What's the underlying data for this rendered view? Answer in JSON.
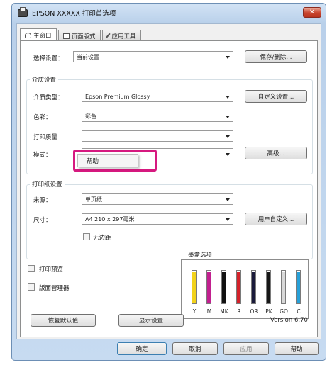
{
  "window": {
    "title": "EPSON XXXXX 打印首选项",
    "close": "✕"
  },
  "tabs": [
    {
      "label": "主窗口",
      "icon": "main-tab-icon"
    },
    {
      "label": "页面版式",
      "icon": "page-layout-icon"
    },
    {
      "label": "应用工具",
      "icon": "utility-tools-icon"
    }
  ],
  "select_setting": {
    "label": "选择设置：",
    "value": "当前设置",
    "save_button": "保存/删除..."
  },
  "media": {
    "group_title": "介质设置",
    "media_type_label": "介质类型：",
    "media_type_value": "Epson Premium Glossy",
    "custom_button": "自定义设置...",
    "color_label": "色彩：",
    "color_value": "彩色",
    "quality_label": "打印质量",
    "quality_value": "",
    "mode_label": "模式：",
    "mode_value": "",
    "advanced_button": "高级..."
  },
  "help_popup": {
    "label": "帮助"
  },
  "paper": {
    "group_title": "打印纸设置",
    "source_label": "来源：",
    "source_value": "单页纸",
    "size_label": "尺寸：",
    "size_value": "A4 210 x 297毫米",
    "user_defined_button": "用户自定义...",
    "borderless_label": "无边距"
  },
  "options": {
    "print_preview": "打印预览",
    "layout_manager": "版面管理器"
  },
  "ink": {
    "title": "墨盒选项",
    "cartridges": [
      {
        "label": "Y",
        "color": "#f2d21a",
        "level": 0.95
      },
      {
        "label": "M",
        "color": "#c2208f",
        "level": 0.95
      },
      {
        "label": "MK",
        "color": "#111111",
        "level": 0.95
      },
      {
        "label": "R",
        "color": "#d4222a",
        "level": 0.95
      },
      {
        "label": "OR",
        "color": "#1a1a3a",
        "level": 0.95
      },
      {
        "label": "PK",
        "color": "#161616",
        "level": 0.95
      },
      {
        "label": "GO",
        "color": "#d8d8d8",
        "level": 0.95
      },
      {
        "label": "C",
        "color": "#27a0d8",
        "level": 0.95
      }
    ]
  },
  "bottom": {
    "restore_defaults": "恢复默认值",
    "show_settings": "显示设置",
    "version": "Version 6.70"
  },
  "footer": {
    "ok": "确定",
    "cancel": "取消",
    "apply": "应用",
    "help": "帮助"
  }
}
